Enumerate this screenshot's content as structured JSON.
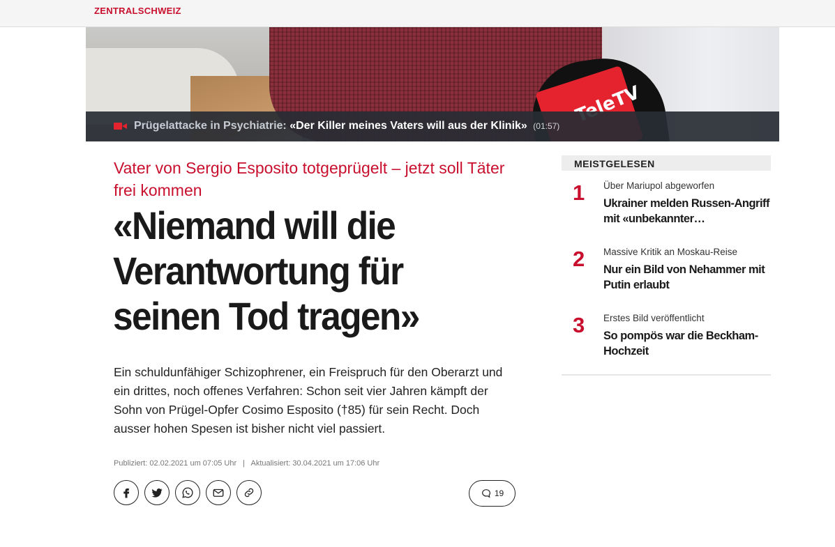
{
  "header": {
    "brand": "ZENTRALSCHWEIZ"
  },
  "video": {
    "category": "Prügelattacke in Psychiatrie:",
    "title": "«Der Killer meines Vaters will aus der Klinik»",
    "duration": "(01:57)",
    "mic_logo": "TeleTV"
  },
  "article": {
    "kicker": "Vater von Sergio Esposito totgeprügelt – jetzt soll Täter frei kommen",
    "headline": "«Niemand will die Verantwortung für seinen Tod tragen»",
    "lead": "Ein schuldunfähiger Schizophrener, ein Freispruch für den Oberarzt und ein drittes, noch offenes Verfahren: Schon seit vier Jahren kämpft der Sohn von Prügel-Opfer Cosimo Esposito (†85) für sein Recht. Doch ausser hohen Spesen ist bisher nicht viel passiert.",
    "published": "Publiziert: 02.02.2021 um 07:05 Uhr",
    "separator": "|",
    "updated": "Aktualisiert: 30.04.2021 um 17:06 Uhr",
    "comment_count": "19"
  },
  "share": {
    "icons": [
      "facebook-icon",
      "twitter-icon",
      "whatsapp-icon",
      "email-icon",
      "link-icon"
    ]
  },
  "sidebar": {
    "title": "MEISTGELESEN",
    "items": [
      {
        "rank": "1",
        "kicker": "Über Mariupol abgeworfen",
        "title": "Ukrainer melden Russen-Angriff mit «unbekannter…"
      },
      {
        "rank": "2",
        "kicker": "Massive Kritik an Moskau-Reise",
        "title": "Nur ein Bild von Nehammer mit Putin erlaubt"
      },
      {
        "rank": "3",
        "kicker": "Erstes Bild veröffentlicht",
        "title": "So pompös war die Beckham-Hochzeit"
      }
    ]
  },
  "colors": {
    "accent": "#c8102e",
    "caption_bar": "#2c3038"
  }
}
